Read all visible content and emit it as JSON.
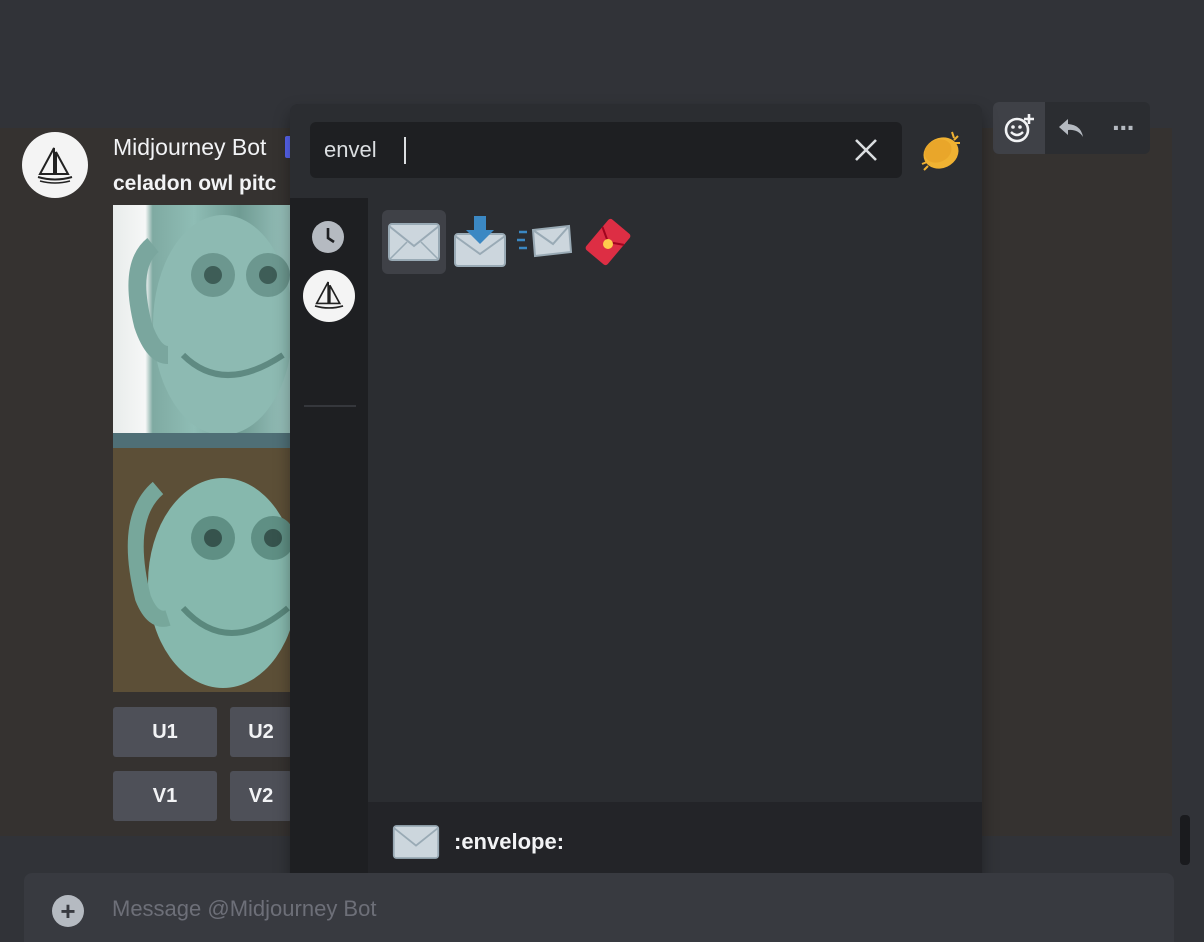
{
  "colors": {
    "background": "#313338",
    "message_area": "#353230",
    "picker_bg": "#2b2d31",
    "search_bg": "#1e1f22",
    "button_bg": "#4e5058",
    "accent_bot_badge": "#5865f2"
  },
  "message": {
    "author": "Midjourney Bot",
    "prompt": "celadon owl pitc",
    "avatar_icon": "sailboat-icon",
    "images": [
      "owl-pitcher-image-1",
      "owl-pitcher-image-3"
    ],
    "buttons_row1": [
      "U1",
      "U2"
    ],
    "buttons_row2": [
      "V1",
      "V2"
    ]
  },
  "hover_toolbar": {
    "items": [
      "add-reaction-icon",
      "reply-icon",
      "more-icon"
    ],
    "more_glyph": "···"
  },
  "emoji_picker": {
    "search": {
      "value": "envel"
    },
    "sidebar": [
      "recent-clock-icon",
      "server-midjourney-icon"
    ],
    "results": [
      "envelope",
      "envelope_with_arrow",
      "incoming_envelope",
      "red_envelope"
    ],
    "footer": {
      "name": ":envelope:"
    }
  },
  "composer": {
    "placeholder": "Message @Midjourney Bot",
    "add_glyph": "+"
  }
}
